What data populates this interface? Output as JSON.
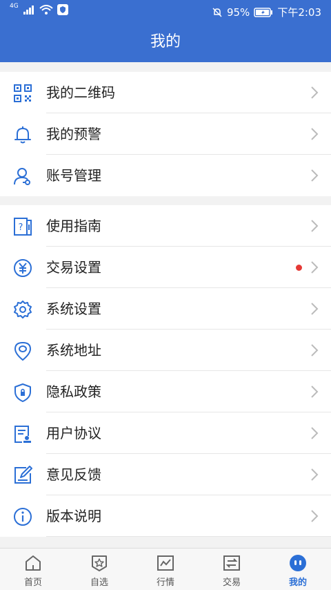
{
  "status": {
    "network": "4G",
    "battery": "95%",
    "time": "下午2:03"
  },
  "header": {
    "title": "我的"
  },
  "group1": [
    {
      "label": "我的二维码",
      "icon": "qr-code-icon"
    },
    {
      "label": "我的预警",
      "icon": "bell-icon"
    },
    {
      "label": "账号管理",
      "icon": "account-icon"
    }
  ],
  "group2": [
    {
      "label": "使用指南",
      "icon": "guide-icon"
    },
    {
      "label": "交易设置",
      "icon": "yuan-icon",
      "badge": true
    },
    {
      "label": "系统设置",
      "icon": "gear-icon"
    },
    {
      "label": "系统地址",
      "icon": "location-icon"
    },
    {
      "label": "隐私政策",
      "icon": "shield-icon"
    },
    {
      "label": "用户协议",
      "icon": "agreement-icon"
    },
    {
      "label": "意见反馈",
      "icon": "feedback-icon"
    },
    {
      "label": "版本说明",
      "icon": "info-icon"
    }
  ],
  "tabs": [
    {
      "label": "首页",
      "icon": "home-icon"
    },
    {
      "label": "自选",
      "icon": "star-icon"
    },
    {
      "label": "行情",
      "icon": "chart-icon"
    },
    {
      "label": "交易",
      "icon": "exchange-icon"
    },
    {
      "label": "我的",
      "icon": "profile-icon",
      "active": true
    }
  ],
  "colors": {
    "primary": "#3a6fd0",
    "icon": "#2b6fd6",
    "badge": "#e53935"
  }
}
